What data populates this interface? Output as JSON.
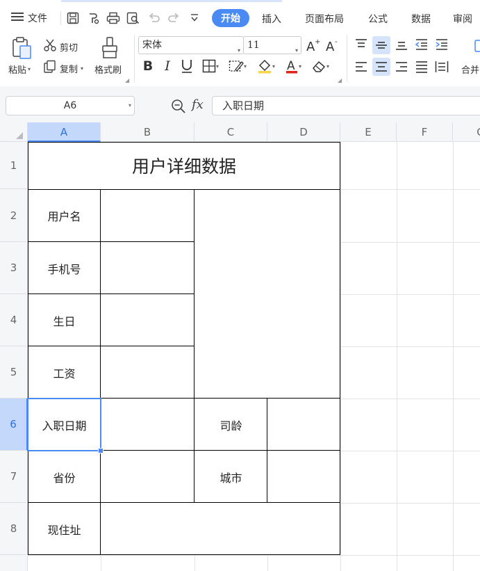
{
  "menubar": {
    "file_label": "文件",
    "tabs": [
      {
        "label": "开始",
        "active": true
      },
      {
        "label": "插入"
      },
      {
        "label": "页面布局"
      },
      {
        "label": "公式"
      },
      {
        "label": "数据"
      },
      {
        "label": "审阅"
      }
    ],
    "quick_icons": [
      "save-icon",
      "format-painter-icon",
      "print-icon",
      "print-preview-icon",
      "undo-icon",
      "redo-icon",
      "more-dropdown-icon"
    ]
  },
  "ribbon": {
    "paste_label": "粘贴",
    "cut_label": "剪切",
    "copy_label": "复制",
    "format_painter_label": "格式刷",
    "font_name": "宋体",
    "font_size": "11",
    "merge_label": "合并"
  },
  "formula_bar": {
    "name_box": "A6",
    "fx_label": "fx",
    "content": "入职日期"
  },
  "grid": {
    "columns": [
      "A",
      "B",
      "C",
      "D",
      "E",
      "F",
      "G"
    ],
    "rows": [
      "1",
      "2",
      "3",
      "4",
      "5",
      "6",
      "7",
      "8"
    ],
    "active_column": "A",
    "active_row": "6",
    "cells": {
      "title": "用户详细数据",
      "username": "用户名",
      "phone": "手机号",
      "birthday": "生日",
      "salary": "工资",
      "hire_date": "入职日期",
      "seniority": "司龄",
      "province": "省份",
      "city": "城市",
      "address": "现住址"
    }
  },
  "colors": {
    "accent": "#4a8af4",
    "header_bg": "#f5f6f7",
    "active_header_bg": "#c3d8fb"
  }
}
